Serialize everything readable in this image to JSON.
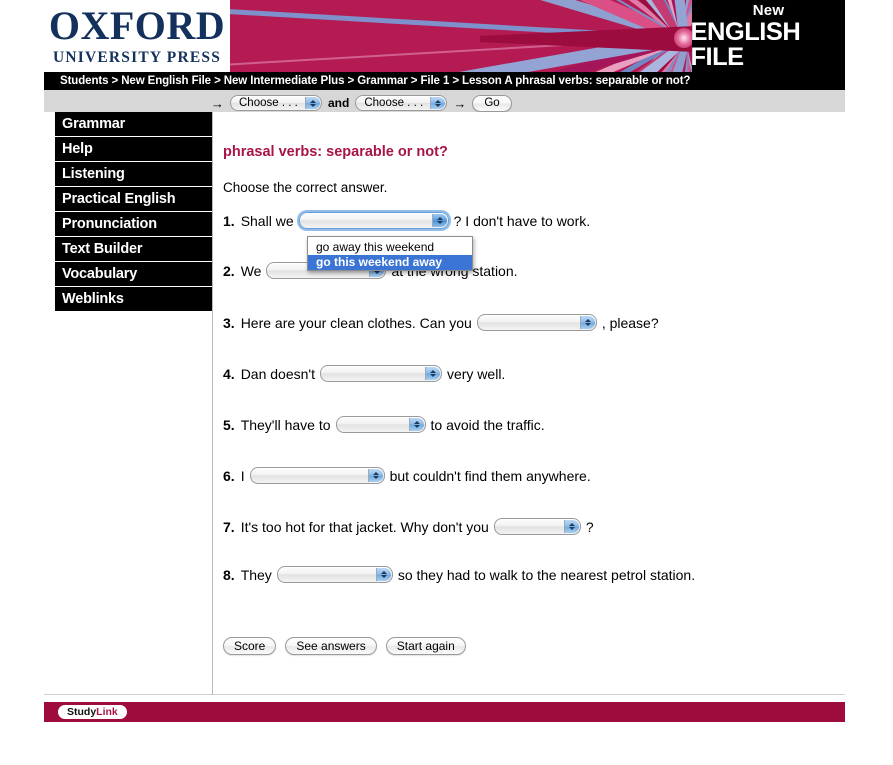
{
  "logo": {
    "main": "OXFORD",
    "sub": "UNIVERSITY PRESS"
  },
  "banner": {
    "new_label": "New",
    "title": "ENGLISH FILE"
  },
  "breadcrumb": {
    "text": "Students > New English File > New Intermediate Plus > Grammar > File 1 > Lesson A phrasal verbs: separable or not?"
  },
  "chooser": {
    "arrow_left": "→",
    "select_one": "Choose . . .",
    "and_label": "and",
    "select_two": "Choose . . .",
    "arrow_right": "→",
    "go_label": "Go"
  },
  "sidebar": {
    "items": [
      {
        "label": "Grammar"
      },
      {
        "label": "Help"
      },
      {
        "label": "Listening"
      },
      {
        "label": "Practical English"
      },
      {
        "label": "Pronunciation"
      },
      {
        "label": "Text Builder"
      },
      {
        "label": "Vocabulary"
      },
      {
        "label": "Weblinks"
      }
    ]
  },
  "exercise": {
    "title": "phrasal verbs: separable or not?",
    "instruction": "Choose the correct answer.",
    "questions": [
      {
        "num": "1.",
        "pre": "Shall we",
        "value": "",
        "post": "? I don't have to work."
      },
      {
        "num": "2.",
        "pre": "We",
        "value": "",
        "post": "at the wrong station."
      },
      {
        "num": "3.",
        "pre": "Here are your clean clothes. Can you",
        "value": "",
        "post": ", please?"
      },
      {
        "num": "4.",
        "pre": "Dan doesn't",
        "value": "",
        "post": "very well."
      },
      {
        "num": "5.",
        "pre": "They'll have to",
        "value": "",
        "post": "to avoid the traffic."
      },
      {
        "num": "6.",
        "pre": "I",
        "value": "",
        "post": "but couldn't find them anywhere."
      },
      {
        "num": "7.",
        "pre": "It's too hot for that jacket. Why don't you",
        "value": "",
        "post": "?"
      },
      {
        "num": "8.",
        "pre": "They",
        "value": "",
        "post": "so they had to walk to the nearest petrol station."
      }
    ],
    "open_dropdown": {
      "belongs_to_question": "1.",
      "options": [
        {
          "label": "go away this weekend",
          "selected": false
        },
        {
          "label": "go this weekend away",
          "selected": true
        }
      ]
    },
    "buttons": [
      {
        "label": "Score"
      },
      {
        "label": "See answers"
      },
      {
        "label": "Start again"
      }
    ]
  },
  "footer": {
    "study": "Study",
    "link": "Link"
  },
  "colors": {
    "brand_crimson": "#a8144a",
    "footer_bar": "#9e0b3d",
    "oxford_navy": "#13315c",
    "highlight_blue": "#3a74d4",
    "nav_gray": "#d7d7d7"
  }
}
